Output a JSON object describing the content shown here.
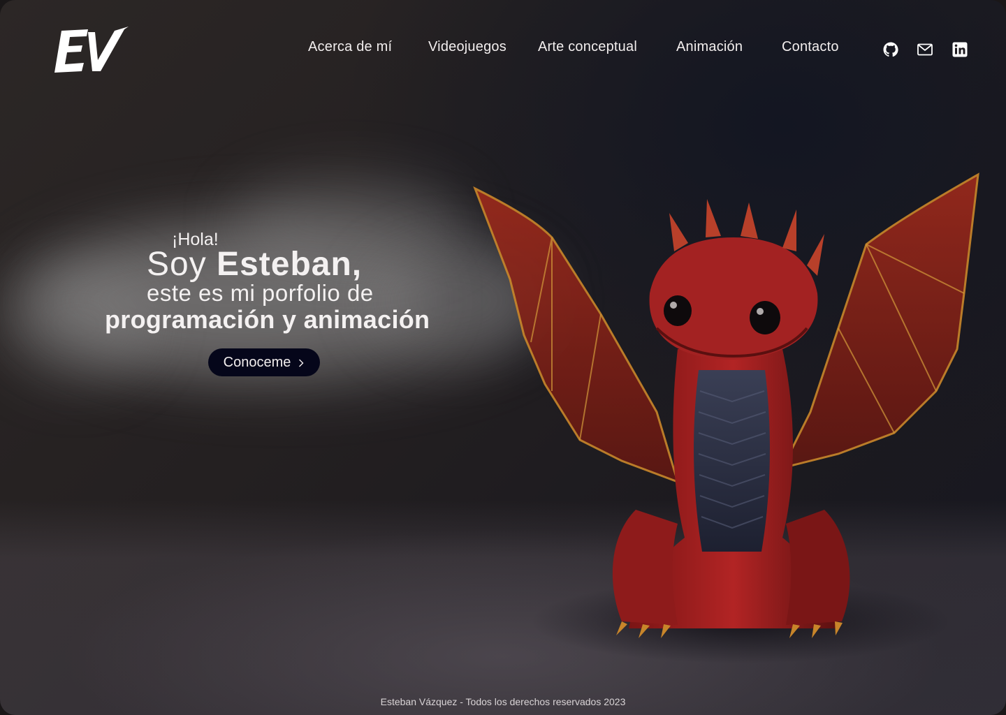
{
  "header": {
    "logo_text": "EV",
    "nav": [
      {
        "label": "Acerca de mí"
      },
      {
        "label": "Videojuegos"
      },
      {
        "label": "Arte conceptual"
      },
      {
        "label": "Animación"
      },
      {
        "label": "Contacto"
      }
    ],
    "social": [
      {
        "icon": "github-icon"
      },
      {
        "icon": "mail-icon"
      },
      {
        "icon": "linkedin-icon"
      }
    ]
  },
  "hero": {
    "greeting": "¡Hola!",
    "soy": "Soy ",
    "name": "Esteban,",
    "line3": "este es mi porfolio de",
    "line4": "programación y animación",
    "cta_label": "Conoceme"
  },
  "footer": {
    "text": "Esteban Vázquez - Todos los derechos reservados 2023"
  },
  "colors": {
    "cta_background": "#05061a",
    "text": "#f2eeee",
    "dragon_red": "#a51e1e"
  }
}
